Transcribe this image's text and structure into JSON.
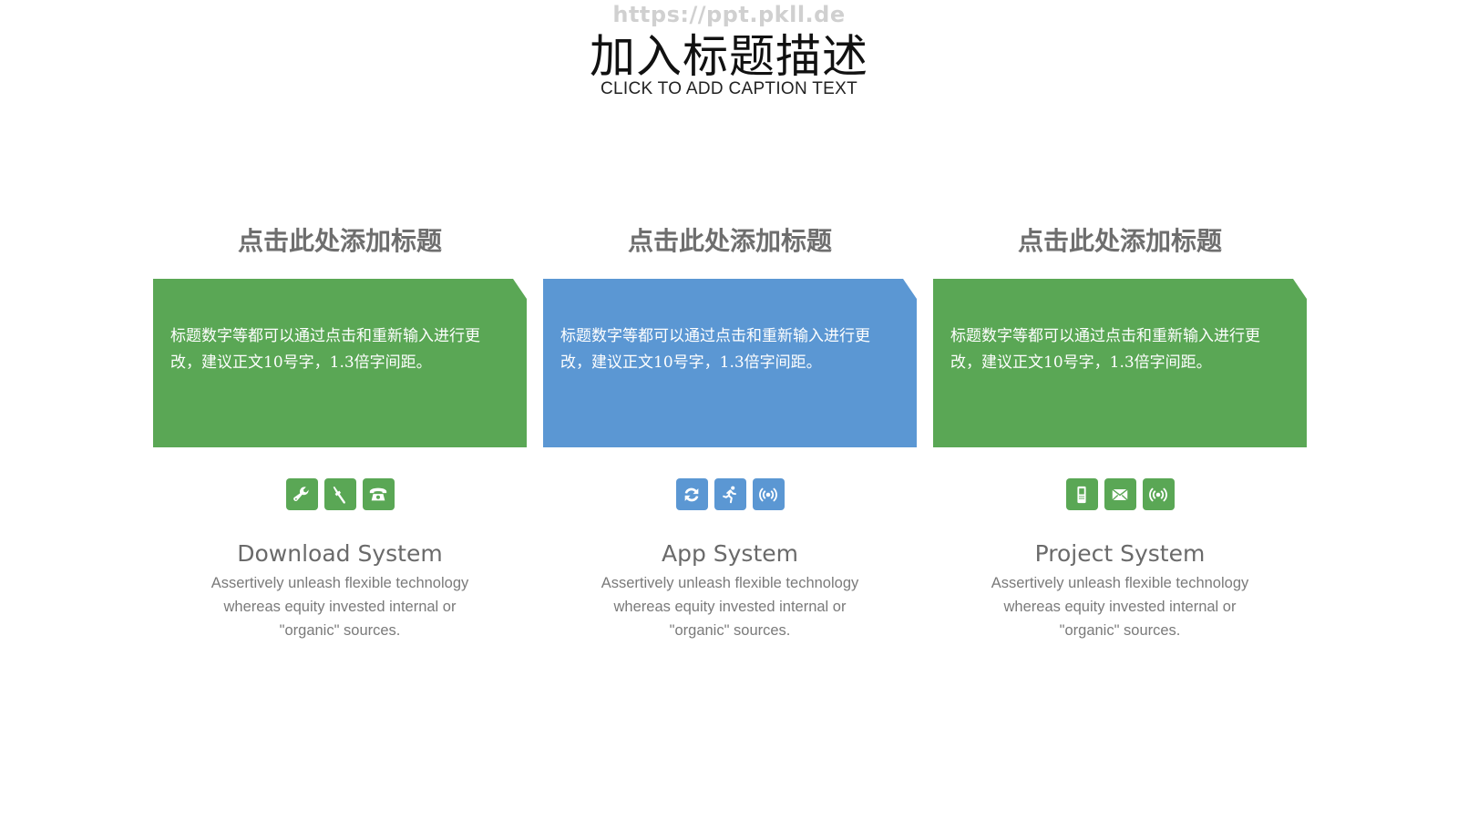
{
  "watermark": "https://ppt.pkll.de",
  "title": "加入标题描述",
  "subtitle": "CLICK TO ADD CAPTION TEXT",
  "columns": [
    {
      "heading": "点击此处添加标题",
      "card_text": "标题数字等都可以通过点击和重新输入进行更改，建议正文10号字，1.3倍字间距。",
      "card_color": "#5aa755",
      "icon_color": "#5aa755",
      "icons": [
        "wrench-icon",
        "screwdriver-icon",
        "telephone-icon"
      ],
      "title": "Download System",
      "description": "Assertively unleash flexible technology whereas equity invested internal or \"organic\" sources."
    },
    {
      "heading": "点击此处添加标题",
      "card_text": "标题数字等都可以通过点击和重新输入进行更改，建议正文10号字，1.3倍字间距。",
      "card_color": "#5b97d3",
      "icon_color": "#5b97d3",
      "icons": [
        "refresh-icon",
        "running-person-icon",
        "broadcast-icon"
      ],
      "title": "App System",
      "description": "Assertively unleash flexible technology whereas equity invested internal or \"organic\" sources."
    },
    {
      "heading": "点击此处添加标题",
      "card_text": "标题数字等都可以通过点击和重新输入进行更改，建议正文10号字，1.3倍字间距。",
      "card_color": "#5aa755",
      "icon_color": "#5aa755",
      "icons": [
        "mobile-phone-icon",
        "envelope-icon",
        "broadcast-icon"
      ],
      "title": "Project System",
      "description": "Assertively unleash flexible technology whereas equity invested internal or \"organic\" sources."
    }
  ]
}
